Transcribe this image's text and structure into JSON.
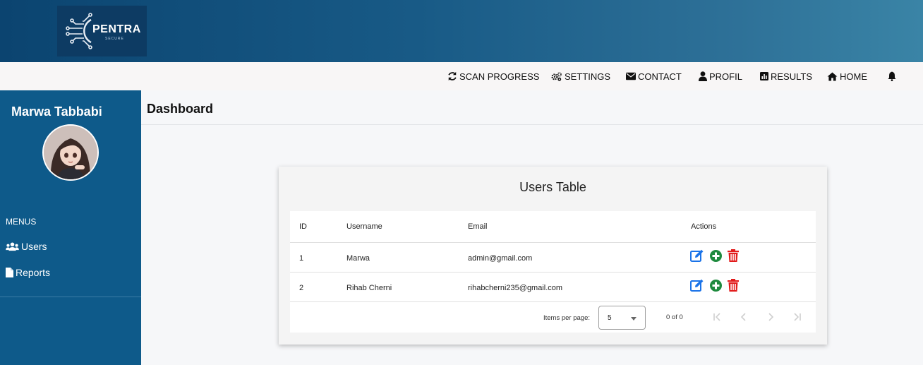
{
  "brand": {
    "name": "PENTRA",
    "tagline": "SECURE"
  },
  "nav": {
    "scan_progress": "SCAN PROGRESS",
    "settings": "SETTINGS",
    "contact": "CONTACT",
    "profil": "PROFIL",
    "results": "RESULTS",
    "home": "HOME"
  },
  "sidebar": {
    "user_name": "Marwa Tabbabi",
    "menus_label": "MENUS",
    "items": [
      {
        "label": "Users",
        "icon": "users-icon"
      },
      {
        "label": "Reports",
        "icon": "file-icon"
      }
    ]
  },
  "page": {
    "title": "Dashboard"
  },
  "users_table": {
    "title": "Users Table",
    "columns": [
      "ID",
      "Username",
      "Email",
      "Actions"
    ],
    "rows": [
      {
        "id": "1",
        "username": "Marwa",
        "email": "admin@gmail.com"
      },
      {
        "id": "2",
        "username": "Rihab Cherni",
        "email": "rihabcherni235@gmail.com"
      }
    ],
    "actions": [
      "edit-icon",
      "add-circle-icon",
      "trash-icon"
    ]
  },
  "paginator": {
    "items_per_page_label": "Items per page:",
    "page_size": "5",
    "range_label": "0 of 0"
  },
  "colors": {
    "sidebar": "#0e5a8a",
    "topbar_start": "#0b4470",
    "topbar_end": "#3a84a6",
    "edit": "#1a73e8",
    "add": "#1e8a3e",
    "delete": "#e21b1b"
  }
}
